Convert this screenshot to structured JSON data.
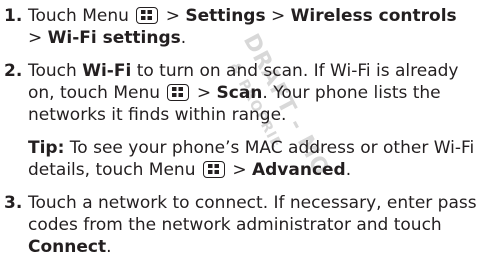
{
  "watermark": {
    "line1": "DRAFT - MO",
    "line2": "& PROPRIE"
  },
  "icons": {
    "menu_key": "menu-key-icon"
  },
  "steps": [
    {
      "number": "1.",
      "t1": "Touch Menu",
      "t2": ">",
      "b1": "Settings",
      "t3": ">",
      "b2": "Wireless controls",
      "t4": ">",
      "b3": "Wi-Fi settings",
      "t5": "."
    },
    {
      "number": "2.",
      "t1": "Touch",
      "b1": "Wi-Fi",
      "t2": "to turn on and scan. If Wi-Fi is already on, touch Menu",
      "t3": ">",
      "b2": "Scan",
      "t4": ". Your phone lists the networks it finds within range."
    },
    {
      "number": "3.",
      "t1": "Touch a network to connect. If necessary, enter pass codes from the network administrator and touch",
      "b1": "Connect",
      "t2": "."
    }
  ],
  "tip": {
    "label": "Tip:",
    "t1": "To see your phone’s MAC address or other Wi-Fi details, touch Menu",
    "t2": ">",
    "b1": "Advanced",
    "t3": "."
  }
}
